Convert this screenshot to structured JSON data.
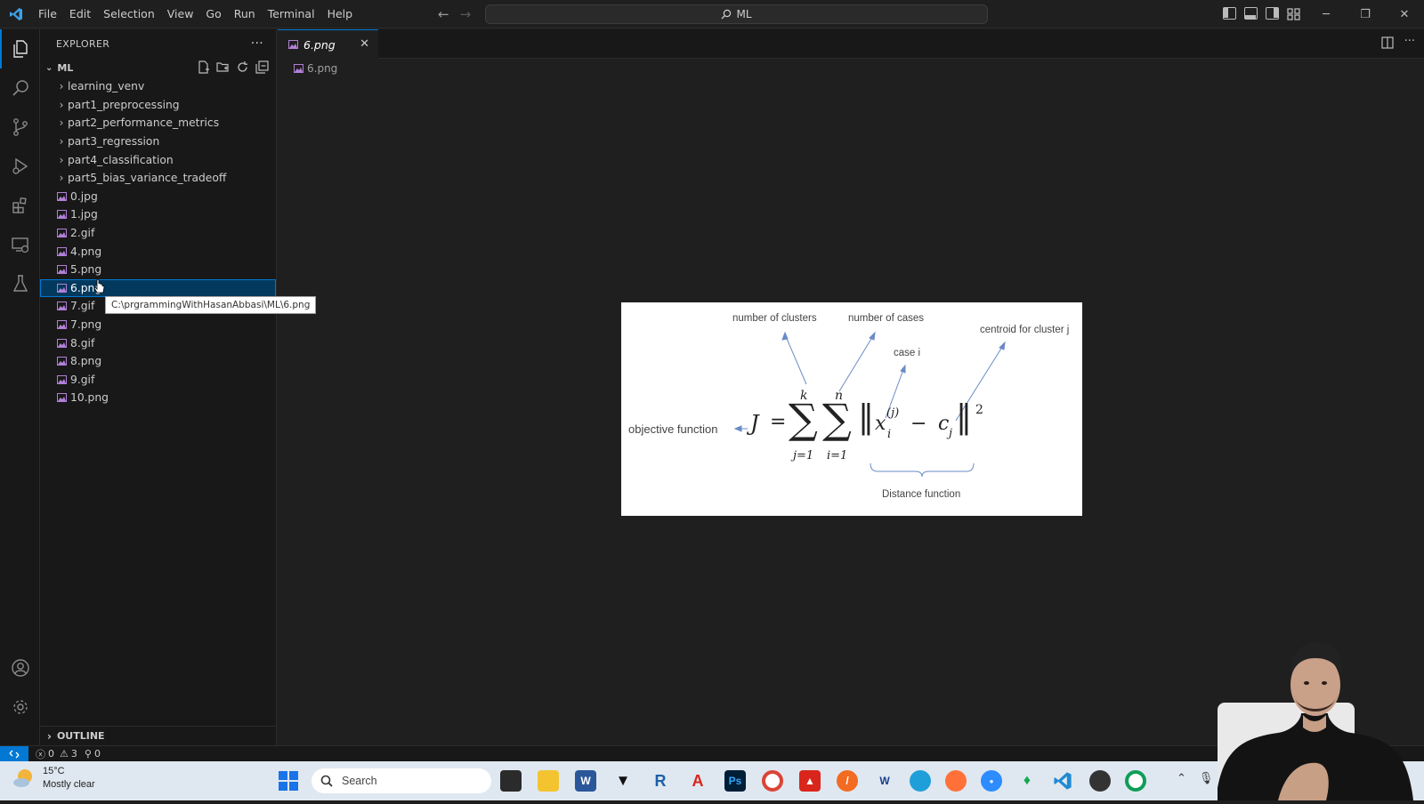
{
  "menu": [
    "File",
    "Edit",
    "Selection",
    "View",
    "Go",
    "Run",
    "Terminal",
    "Help"
  ],
  "command_center": {
    "text": "ML"
  },
  "explorer": {
    "title": "EXPLORER",
    "more": "···",
    "root": "ML",
    "folders": [
      "learning_venv",
      "part1_preprocessing",
      "part2_performance_metrics",
      "part3_regression",
      "part4_classification",
      "part5_bias_variance_tradeoff"
    ],
    "files": [
      "0.jpg",
      "1.jpg",
      "2.gif",
      "4.png",
      "5.png",
      "6.png",
      "7.gif",
      "7.png",
      "8.gif",
      "8.png",
      "9.gif",
      "10.png"
    ],
    "selected_file": "6.png",
    "tooltip": "C:\\prgrammingWithHasanAbbasi\\ML\\6.png",
    "outline": "OUTLINE"
  },
  "editor": {
    "tab": {
      "label": "6.png",
      "close": "✕"
    },
    "breadcrumb": "6.png",
    "formula": {
      "label_clusters": "number of clusters",
      "label_cases": "number of cases",
      "label_case_i": "case i",
      "label_centroid": "centroid for cluster j",
      "label_objective": "objective function",
      "label_distance": "Distance function",
      "upper_k": "k",
      "upper_n": "n",
      "lower_j": "j=1",
      "lower_i": "i=1",
      "J": "J",
      "equals": "=",
      "sigma": "∑",
      "x": "x",
      "sup_j": "(j)",
      "sub_i": "i",
      "minus": "−",
      "c": "c",
      "sub_j": "j",
      "norm": "‖",
      "squared": "2",
      "arrow": "←"
    }
  },
  "statusbar": {
    "errors": "0",
    "warnings": "3",
    "ports": "0"
  },
  "taskbar": {
    "temperature": "15°C",
    "condition": "Mostly clear",
    "search": "Search"
  },
  "colors": {
    "accent": "#0078d4",
    "selection": "#04395e",
    "image_icon": "#b180d7"
  }
}
